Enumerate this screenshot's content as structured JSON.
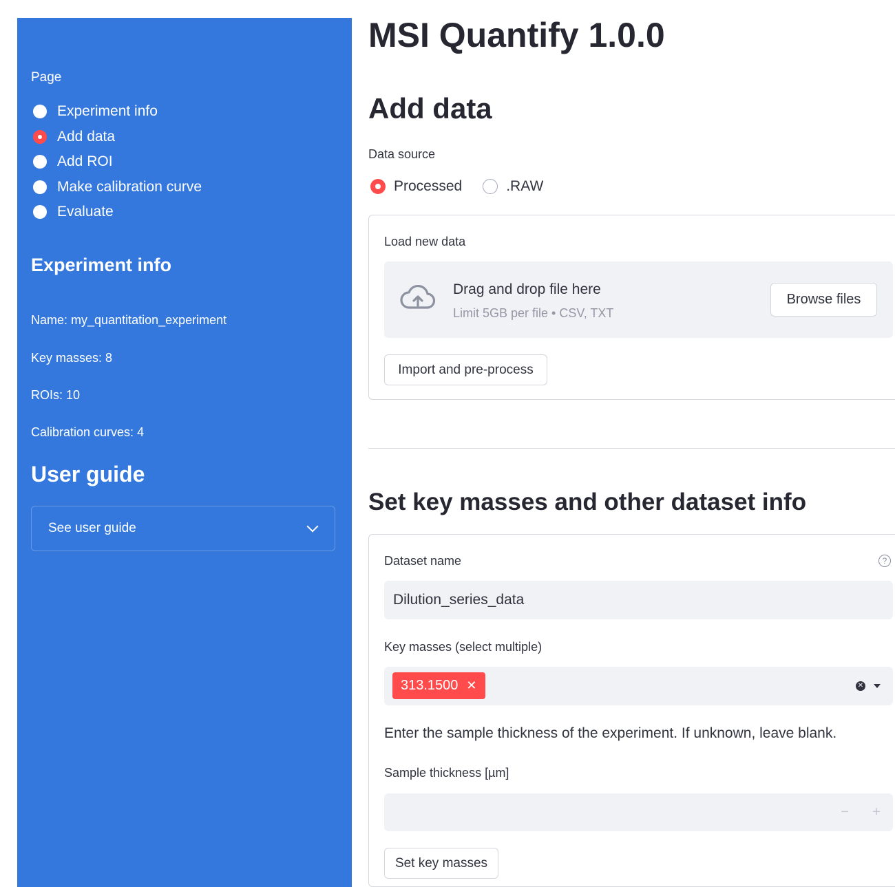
{
  "app": {
    "title": "MSI Quantify 1.0.0"
  },
  "sidebar": {
    "page_label": "Page",
    "nav": [
      {
        "label": "Experiment info",
        "selected": false
      },
      {
        "label": "Add data",
        "selected": true
      },
      {
        "label": "Add ROI",
        "selected": false
      },
      {
        "label": "Make calibration curve",
        "selected": false
      },
      {
        "label": "Evaluate",
        "selected": false
      }
    ],
    "experiment_heading": "Experiment info",
    "info": {
      "name": "Name: my_quantitation_experiment",
      "key_masses": "Key masses: 8",
      "rois": "ROIs: 10",
      "calibration_curves": "Calibration curves: 4"
    },
    "guide_heading": "User guide",
    "guide_expander": "See user guide"
  },
  "main": {
    "add_data_heading": "Add data",
    "data_source_label": "Data source",
    "data_source_options": [
      {
        "label": "Processed",
        "selected": true
      },
      {
        "label": ".RAW",
        "selected": false
      }
    ],
    "load_label": "Load new data",
    "uploader": {
      "title": "Drag and drop file here",
      "subtitle": "Limit 5GB per file • CSV, TXT",
      "browse_label": "Browse files"
    },
    "import_label": "Import and pre-process",
    "set_heading": "Set key masses and other dataset info",
    "dataset_name_label": "Dataset name",
    "dataset_name_value": "Dilution_series_data",
    "key_masses_label": "Key masses (select multiple)",
    "key_masses_selected": [
      "313.1500"
    ],
    "thickness_text": "Enter the sample thickness of the experiment. If unknown, leave blank.",
    "thickness_label": "Sample thickness [µm]",
    "thickness_value": "",
    "set_button_label": "Set key masses"
  },
  "colors": {
    "sidebar_bg": "#3478de",
    "accent": "#ff4b4b",
    "input_bg": "#f0f2f6"
  }
}
